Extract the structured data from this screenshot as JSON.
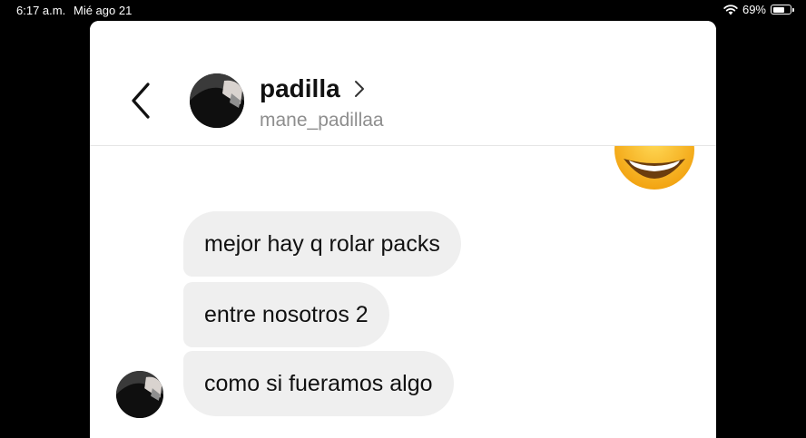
{
  "status_bar": {
    "time": "6:17 a.m.",
    "date": "Mié ago 21",
    "battery_percent": "69%",
    "battery_level": 0.69,
    "wifi_icon": "wifi-icon"
  },
  "header": {
    "back_icon": "chevron-left-icon",
    "display_name": "padilla",
    "chevron_icon": "chevron-right-icon",
    "username": "mane_padillaa"
  },
  "messages": [
    {
      "text": "mejor hay q rolar packs"
    },
    {
      "text": "entre nosotros 2"
    },
    {
      "text": "como si fueramos algo"
    }
  ],
  "colors": {
    "bubble_bg": "#efefef",
    "secondary_text": "#8e8e8e",
    "emoji_yellow": "#f7b32b"
  }
}
